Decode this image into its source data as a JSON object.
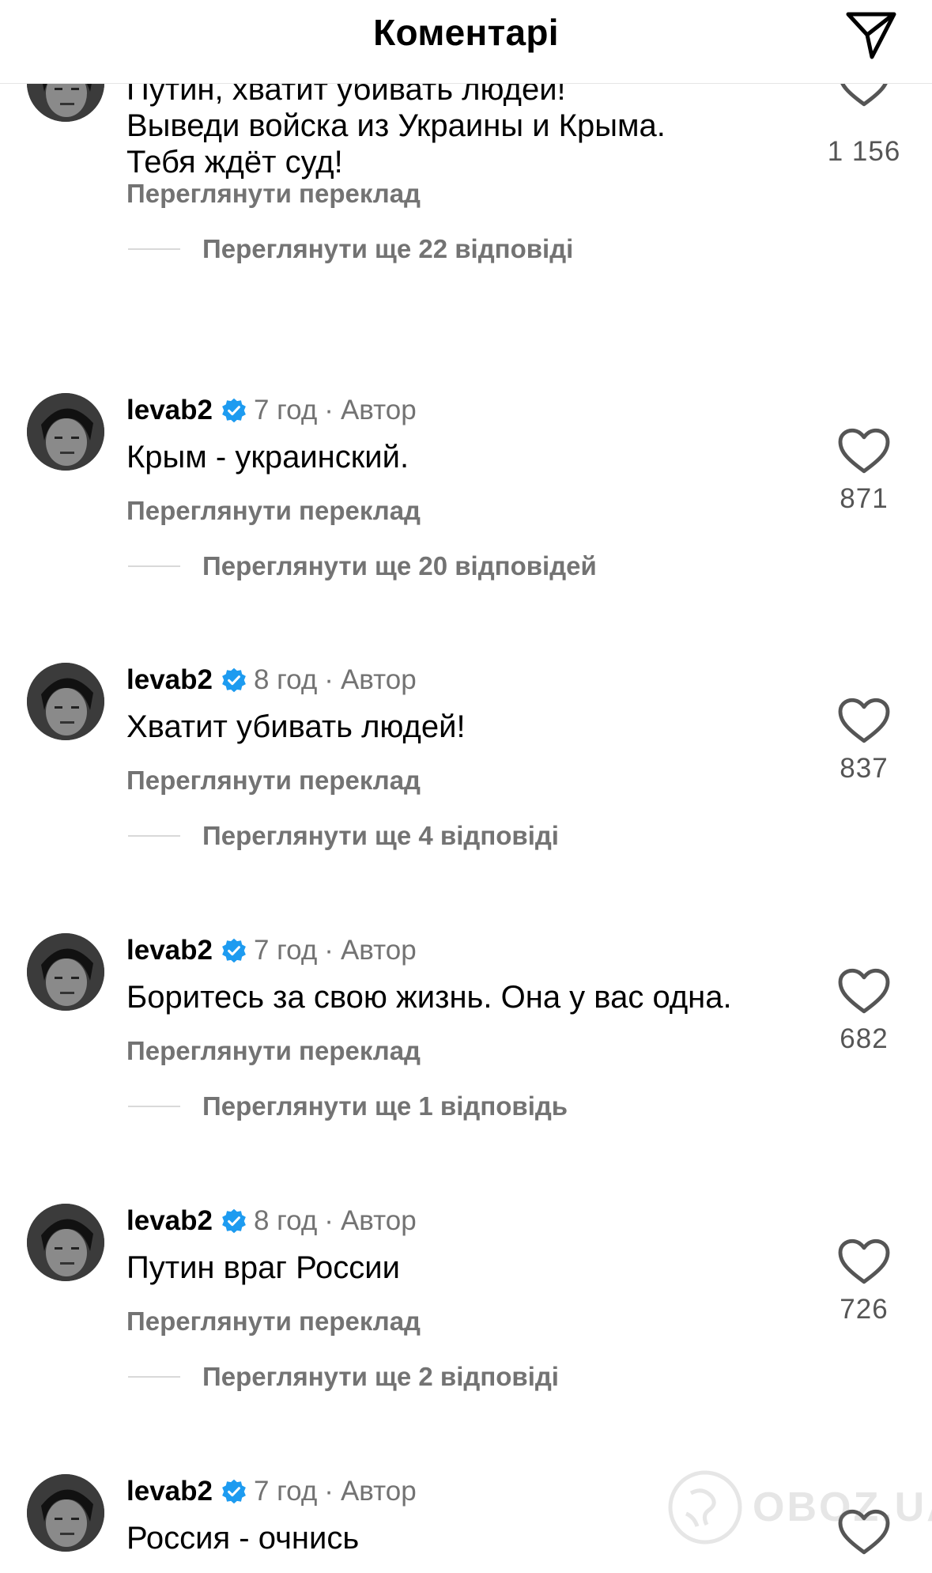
{
  "header": {
    "title": "Коментарі"
  },
  "icons": {
    "send": "paper-plane-icon",
    "like": "heart-outline-icon",
    "verified": "verified-badge-icon"
  },
  "colors": {
    "verified": "#1d9bf0",
    "secondary_text": "#737373",
    "divider": "#d9d9d9"
  },
  "comments": [
    {
      "text": "Путин, хватит убивать людей! Выведи войска из Украины и Крыма. Тебя ждёт суд!",
      "translate": "Переглянути переклад",
      "replies": "Переглянути ще 22 відповіді",
      "likes": "1 156"
    },
    {
      "username": "levab2",
      "time": "7 год",
      "sep": "·",
      "author": "Автор",
      "text": "Крым - украинский.",
      "translate": "Переглянути переклад",
      "replies": "Переглянути ще 20 відповідей",
      "likes": "871"
    },
    {
      "username": "levab2",
      "time": "8 год",
      "sep": "·",
      "author": "Автор",
      "text": "Хватит убивать людей!",
      "translate": "Переглянути переклад",
      "replies": "Переглянути ще 4 відповіді",
      "likes": "837"
    },
    {
      "username": "levab2",
      "time": "7 год",
      "sep": "·",
      "author": "Автор",
      "text": "Боритесь за свою жизнь. Она у вас одна.",
      "translate": "Переглянути переклад",
      "replies": "Переглянути ще 1 відповідь",
      "likes": "682"
    },
    {
      "username": "levab2",
      "time": "8 год",
      "sep": "·",
      "author": "Автор",
      "text": "Путин враг России",
      "translate": "Переглянути переклад",
      "replies": "Переглянути ще 2 відповіді",
      "likes": "726"
    },
    {
      "username": "levab2",
      "time": "7 год",
      "sep": "·",
      "author": "Автор",
      "text": "Россия - очнись"
    }
  ],
  "watermark": {
    "text": "OBOZ.UA"
  }
}
